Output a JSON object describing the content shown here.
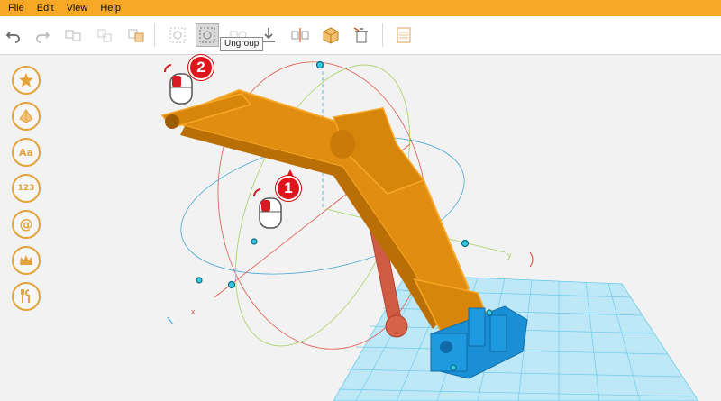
{
  "menu": {
    "file": "File",
    "edit": "Edit",
    "view": "View",
    "help": "Help"
  },
  "toolbar": {
    "tooltip": "Ungroup"
  },
  "sidebar": {
    "text_label": "Aa",
    "number_label": "123",
    "at_label": "@"
  },
  "annotations": {
    "step1": "1",
    "step2": "2"
  },
  "axes": {
    "x": "x",
    "y": "y"
  },
  "colors": {
    "menubar": "#f7a827",
    "arm": "#dd8a0b",
    "base": "#1b8fd6",
    "piston": "#d7624a",
    "grid": "#5bc8ea"
  }
}
